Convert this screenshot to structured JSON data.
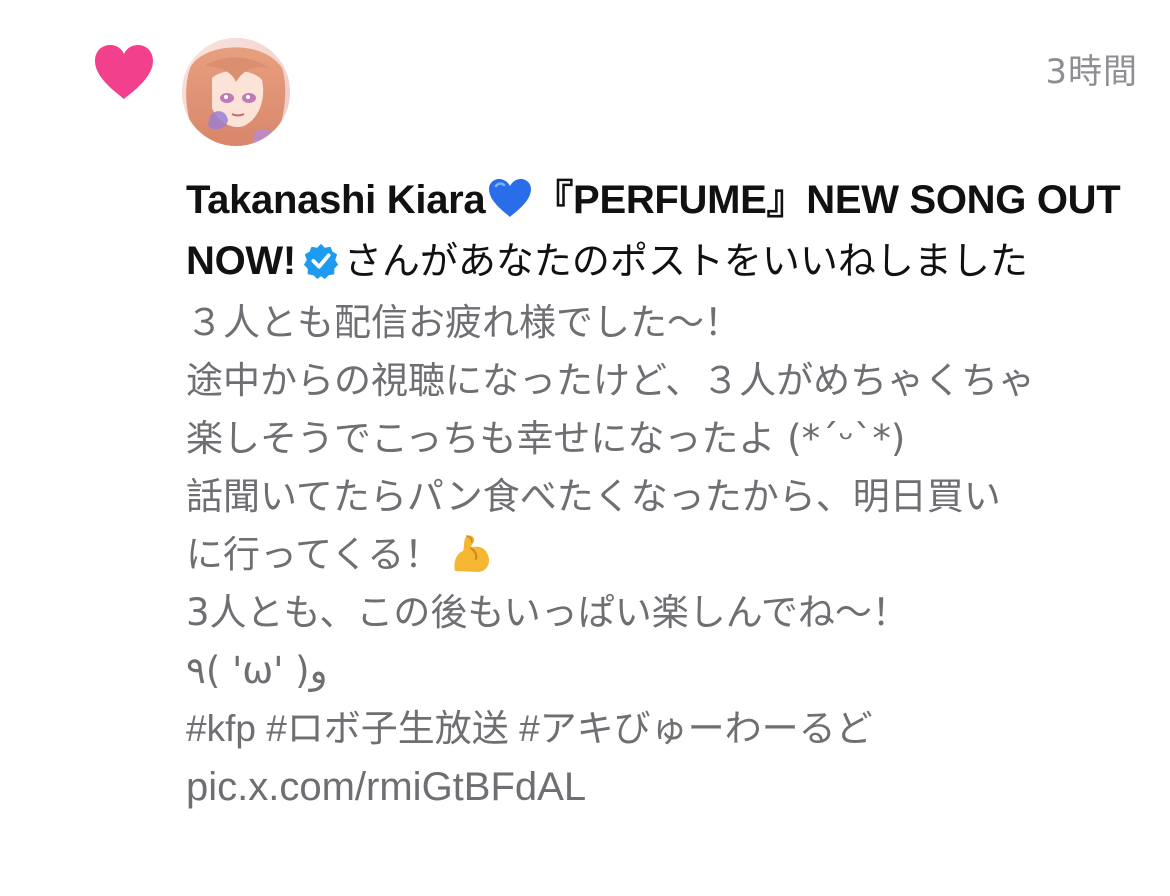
{
  "notification": {
    "type_icon": "heart-icon",
    "timestamp": "3時間",
    "user": {
      "display_name": "Takanashi Kiara",
      "name_suffix": "『PERFUME』NEW SONG OUT NOW!",
      "emoji": "blue-heart-icon",
      "verified_icon": "verified-badge-icon"
    },
    "action_text": "さんがあなたのポストをいいねしました",
    "post": {
      "lines": [
        "３人とも配信お疲れ様でした〜！",
        "途中からの視聴になったけど、３人がめちゃくちゃ",
        "楽しそうでこっちも幸せになったよ (*´ᵕ`*)",
        "話聞いてたらパン食べたくなったから、明日買い",
        "に行ってくる！"
      ],
      "line5_emoji": "flexed-biceps-icon",
      "line6": "3人とも、この後もいっぱい楽しんでね〜！",
      "line7": "٩( 'ω' )و",
      "hashtags": "#kfp #ロボ子生放送 #アキびゅーわーるど",
      "link": "pic.x.com/rmiGtBFdAL"
    },
    "colors": {
      "heart": "#F2408C",
      "verified": "#1D9BF0",
      "primary_text": "#111111",
      "secondary_text": "#6E6E73"
    }
  }
}
